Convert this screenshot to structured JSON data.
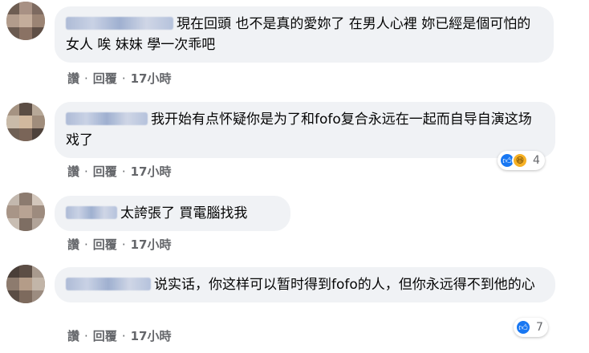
{
  "actions": {
    "like": "讚",
    "reply": "回覆",
    "separator": "·"
  },
  "comments": [
    {
      "text": "現在回頭 也不是真的愛妳了 在男人心裡 妳已經是個可怕的女人 唉 妹妹 學一次乖吧",
      "time": "17小時",
      "reactions": null
    },
    {
      "text": "我开始有点怀疑你是为了和fofo复合永远在一起而自导自演这场戏了",
      "time": "17小時",
      "reactions": {
        "icons": [
          "like-icon",
          "haha-icon"
        ],
        "count": "4"
      }
    },
    {
      "text": "太誇張了 買電腦找我",
      "time": "17小時",
      "reactions": null
    },
    {
      "text": "说实话，你这样可以暂时得到fofo的人，但你永远得不到他的心",
      "time": "17小時",
      "reactions": {
        "icons": [
          "like-icon"
        ],
        "count": "7"
      }
    }
  ],
  "colors": {
    "bubble": "#f0f2f5",
    "meta_text": "#65676b",
    "like_blue": "#1877f2",
    "haha_yellow": "#f7b125"
  }
}
